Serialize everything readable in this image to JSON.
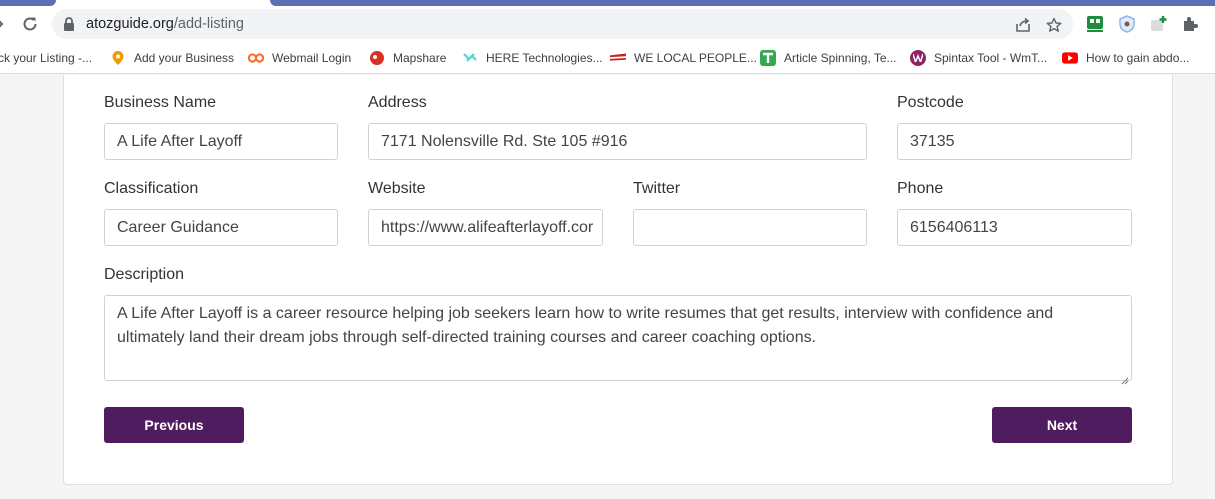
{
  "browser": {
    "url_host": "atozguide.org",
    "url_path": "/add-listing"
  },
  "bookmarks": [
    {
      "label": "ck your Listing -...",
      "icon": "bookmark-page-icon"
    },
    {
      "label": "Add your Business",
      "icon": "pin-icon",
      "color": "#f29900"
    },
    {
      "label": "Webmail Login",
      "icon": "cpanel-icon",
      "color": "#ff6c2c"
    },
    {
      "label": "Mapshare",
      "icon": "mapshare-icon",
      "color": "#d93025"
    },
    {
      "label": "HERE Technologies...",
      "icon": "here-icon",
      "color": "#48dad0"
    },
    {
      "label": "WE LOCAL PEOPLE...",
      "icon": "welocal-icon",
      "color": "#c5221f"
    },
    {
      "label": "Article Spinning, Te...",
      "icon": "t-icon",
      "color": "#34a853"
    },
    {
      "label": "Spintax Tool - WmT...",
      "icon": "wmt-icon",
      "color": "#8e2466"
    },
    {
      "label": "How to gain abdo...",
      "icon": "youtube-icon",
      "color": "#ff0000"
    }
  ],
  "form": {
    "business_name": {
      "label": "Business Name",
      "value": "A Life After Layoff"
    },
    "address": {
      "label": "Address",
      "value": "7171 Nolensville Rd. Ste 105 #916"
    },
    "postcode": {
      "label": "Postcode",
      "value": "37135"
    },
    "classification": {
      "label": "Classification",
      "value": "Career Guidance"
    },
    "website": {
      "label": "Website",
      "value": "https://www.alifeafterlayoff.cor"
    },
    "twitter": {
      "label": "Twitter",
      "value": ""
    },
    "phone": {
      "label": "Phone",
      "value": "6156406113"
    },
    "description": {
      "label": "Description",
      "line1": "A Life After Layoff is a career resource helping job seekers learn how to write resumes that get results, interview with confidence and",
      "line2": "ultimately land their dream jobs through self-directed training courses and career coaching options."
    }
  },
  "buttons": {
    "previous": "Previous",
    "next": "Next"
  },
  "colors": {
    "button": "#4f1c5f",
    "tab_accent": "#5b6fb7"
  }
}
